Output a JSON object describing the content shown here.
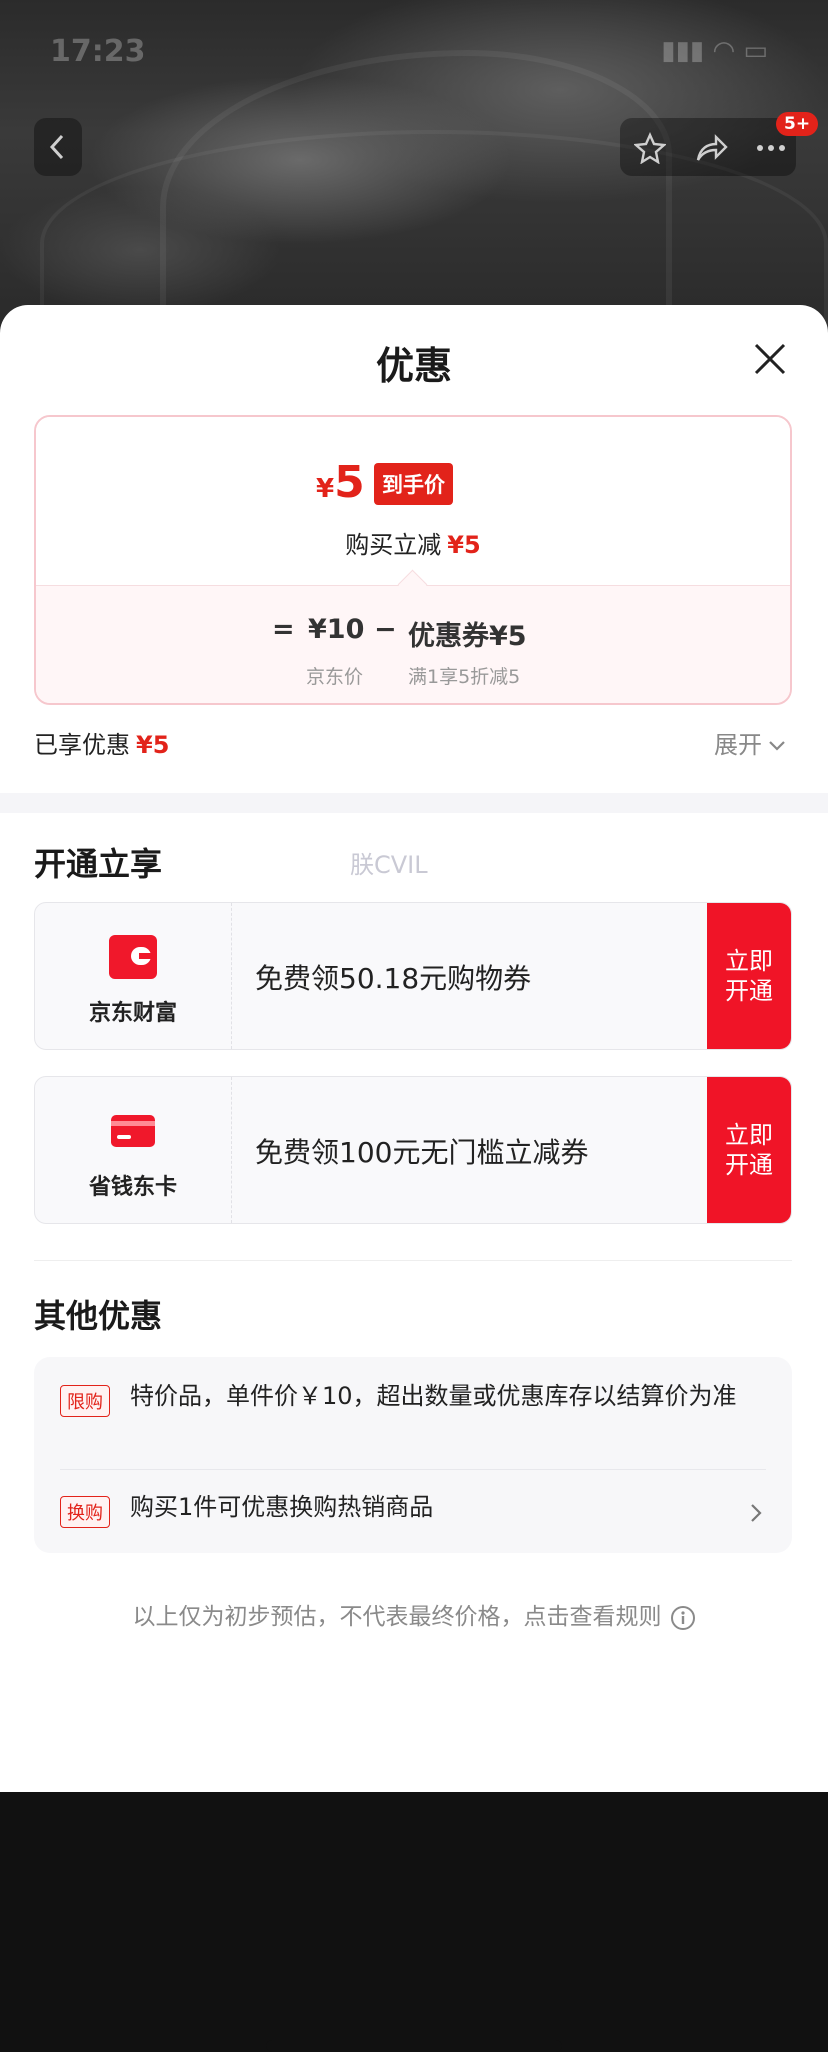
{
  "background": {
    "status_time": "17:23",
    "cart_badge": "5+"
  },
  "sheet": {
    "title": "优惠"
  },
  "price_card": {
    "currency": "¥",
    "final_price": "5",
    "final_tag": "到手价",
    "buy_reduce_label": "购买立减",
    "buy_reduce_amount": "¥5",
    "equals": "=",
    "base_price": "¥10",
    "base_label": "京东价",
    "minus": "−",
    "coupon_price": "优惠券¥5",
    "coupon_label": "满1享5折减5"
  },
  "enjoyed": {
    "label": "已享优惠",
    "amount": "¥5",
    "expand_label": "展开"
  },
  "open_section": {
    "title": "开通立享",
    "watermark": "朕CVIL",
    "items": [
      {
        "brand": "京东财富",
        "desc": "免费领50.18元购物券",
        "action": "立即开通"
      },
      {
        "brand": "省钱东卡",
        "desc": "免费领100元无门槛立减券",
        "action": "立即开通"
      }
    ]
  },
  "other_section": {
    "title": "其他优惠",
    "rows": [
      {
        "tag": "限购",
        "text": "特价品，单件价￥10，超出数量或优惠库存以结算价为准"
      },
      {
        "tag": "换购",
        "text": "购买1件可优惠换购热销商品"
      }
    ]
  },
  "footer": {
    "note": "以上仅为初步预估，不代表最终价格，点击查看规则"
  },
  "colors": {
    "accent": "#e2231a",
    "action": "#f01427"
  }
}
